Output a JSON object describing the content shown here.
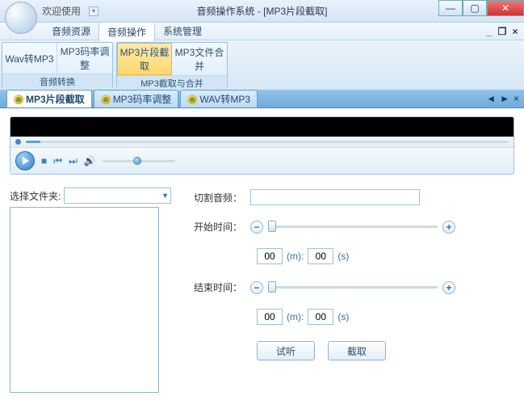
{
  "titlebar": {
    "welcome": "欢迎使用",
    "title": "音频操作系统 - [MP3片段截取]"
  },
  "menu": {
    "items": [
      "音频资源",
      "音频操作",
      "系统管理"
    ]
  },
  "ribbon": {
    "group1": {
      "label": "音频转换",
      "btns": [
        "Wav转MP3",
        "MP3码率调整"
      ]
    },
    "group2": {
      "label": "MP3截取与合并",
      "btns": [
        "MP3片段截取",
        "MP3文件合并"
      ]
    }
  },
  "tabs": {
    "items": [
      "MP3片段截取",
      "MP3码率调整",
      "WAV转MP3"
    ]
  },
  "form": {
    "folder_label": "选择文件夹:",
    "cut_label": "切割音频：",
    "start_label": "开始时间：",
    "end_label": "结束时间：",
    "m_unit": "(m):",
    "s_unit": "(s)",
    "start_m": "00",
    "start_s": "00",
    "end_m": "00",
    "end_s": "00",
    "preview_btn": "试听",
    "cut_btn": "截取"
  }
}
